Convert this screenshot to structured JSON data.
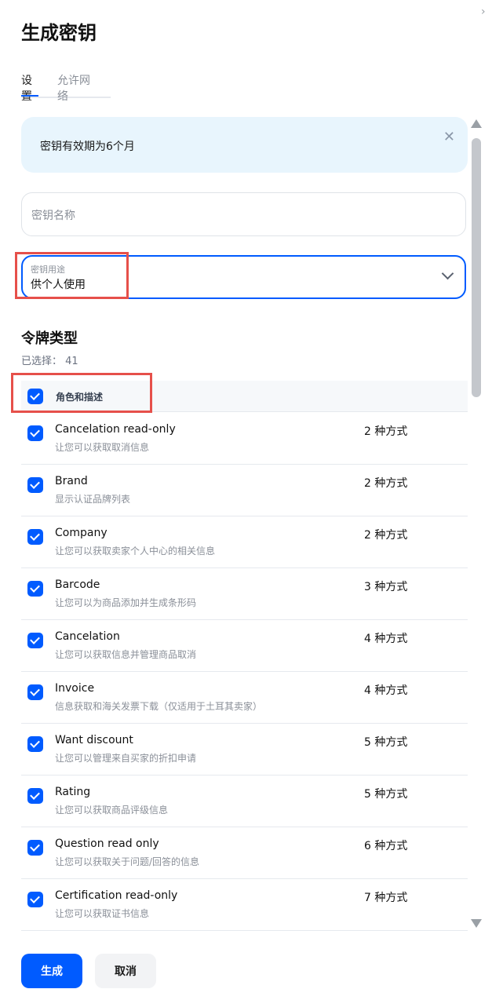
{
  "window": {
    "collapse_icon": "chevron-right-icon"
  },
  "header": {
    "title": "生成密钥"
  },
  "tabs": [
    {
      "label": "设置",
      "active": true
    },
    {
      "label": "允许网络",
      "active": false
    }
  ],
  "banner": {
    "text": "密钥有效期为6个月",
    "close_icon": "close-icon"
  },
  "name_field": {
    "placeholder": "密钥名称",
    "value": ""
  },
  "purpose_field": {
    "label": "密钥用途",
    "value": "供个人使用",
    "icon": "chevron-down-icon"
  },
  "token_types": {
    "title": "令牌类型",
    "selected_label": "已选择： 41",
    "header": {
      "label": "角色和描述",
      "checked": true
    },
    "rows": [
      {
        "name": "Cancelation read-only",
        "desc": "让您可以获取取消信息",
        "count": "2 种方式",
        "checked": true
      },
      {
        "name": "Brand",
        "desc": "显示认证品牌列表",
        "count": "2 种方式",
        "checked": true
      },
      {
        "name": "Company",
        "desc": "让您可以获取卖家个人中心的相关信息",
        "count": "2 种方式",
        "checked": true
      },
      {
        "name": "Barcode",
        "desc": "让您可以为商品添加并生成条形码",
        "count": "3 种方式",
        "checked": true
      },
      {
        "name": "Cancelation",
        "desc": "让您可以获取信息并管理商品取消",
        "count": "4 种方式",
        "checked": true
      },
      {
        "name": "Invoice",
        "desc": "信息获取和海关发票下载（仅适用于土耳其卖家）",
        "count": "4 种方式",
        "checked": true
      },
      {
        "name": "Want discount",
        "desc": "让您可以管理来自买家的折扣申请",
        "count": "5 种方式",
        "checked": true
      },
      {
        "name": "Rating",
        "desc": "让您可以获取商品评级信息",
        "count": "5 种方式",
        "checked": true
      },
      {
        "name": "Question read only",
        "desc": "让您可以获取关于问题/回答的信息",
        "count": "6 种方式",
        "checked": true
      },
      {
        "name": "Certification read-only",
        "desc": "让您可以获取证书信息",
        "count": "7 种方式",
        "checked": true
      }
    ]
  },
  "footer": {
    "generate_label": "生成",
    "cancel_label": "取消"
  },
  "colors": {
    "accent": "#005bff",
    "banner_bg": "#e8f5fd",
    "highlight": "#e6504a"
  }
}
